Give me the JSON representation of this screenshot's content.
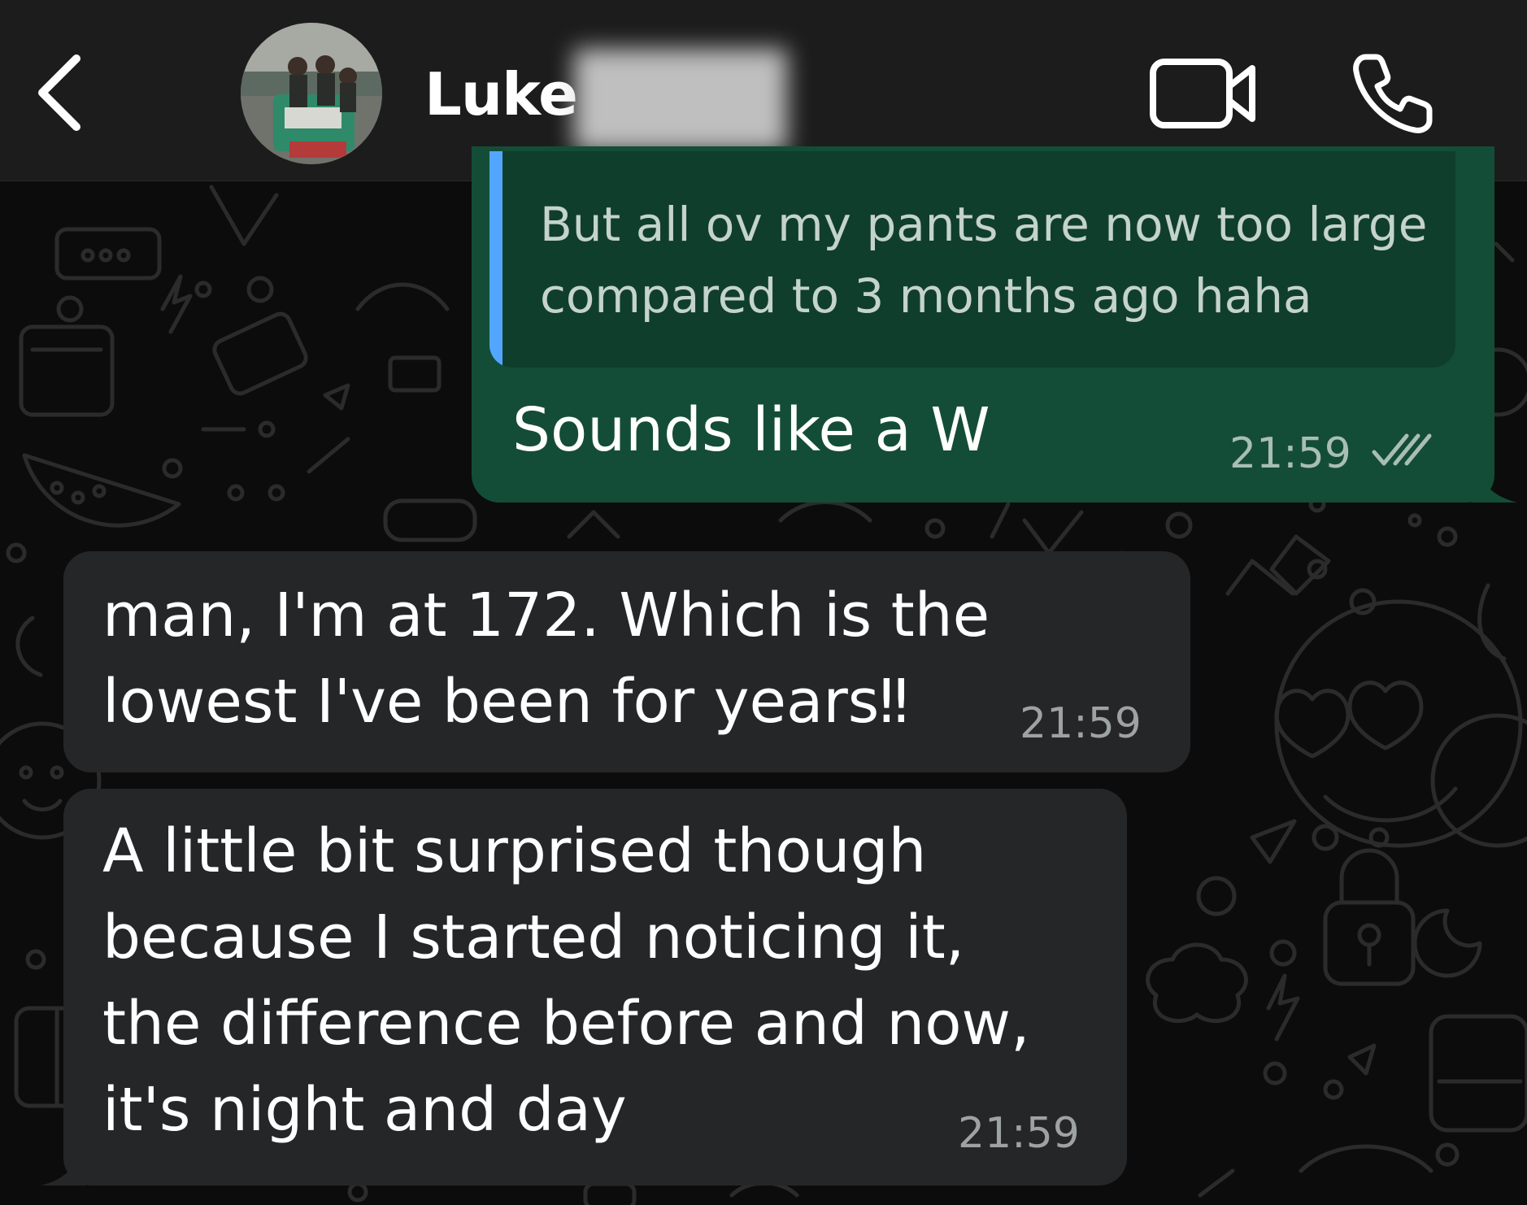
{
  "header": {
    "back_icon": "chevron-left-icon",
    "contact_name": "Luke",
    "video_icon": "video-camera-icon",
    "call_icon": "phone-icon"
  },
  "messages": [
    {
      "direction": "outgoing",
      "quoted_text": "But all ov my pants are now too large compared to 3 months ago haha",
      "text": "Sounds like a W",
      "time": "21:59",
      "status_icon": "double-check-icon"
    },
    {
      "direction": "incoming",
      "lines": [
        "man, I'm at 172. Which is the",
        "lowest I've been for years‼"
      ],
      "time": "21:59"
    },
    {
      "direction": "incoming",
      "lines": [
        "A little bit surprised though",
        "because I started noticing it,",
        "the difference before and now,",
        "it's night and day"
      ],
      "time": "21:59"
    }
  ],
  "colors": {
    "header_bg": "#1c1c1d",
    "chat_bg": "#0c0c0c",
    "outgoing_bubble": "#144d37",
    "outgoing_quote": "#103e2c",
    "quote_accent": "#53a6ff",
    "incoming_bubble": "#252628"
  }
}
